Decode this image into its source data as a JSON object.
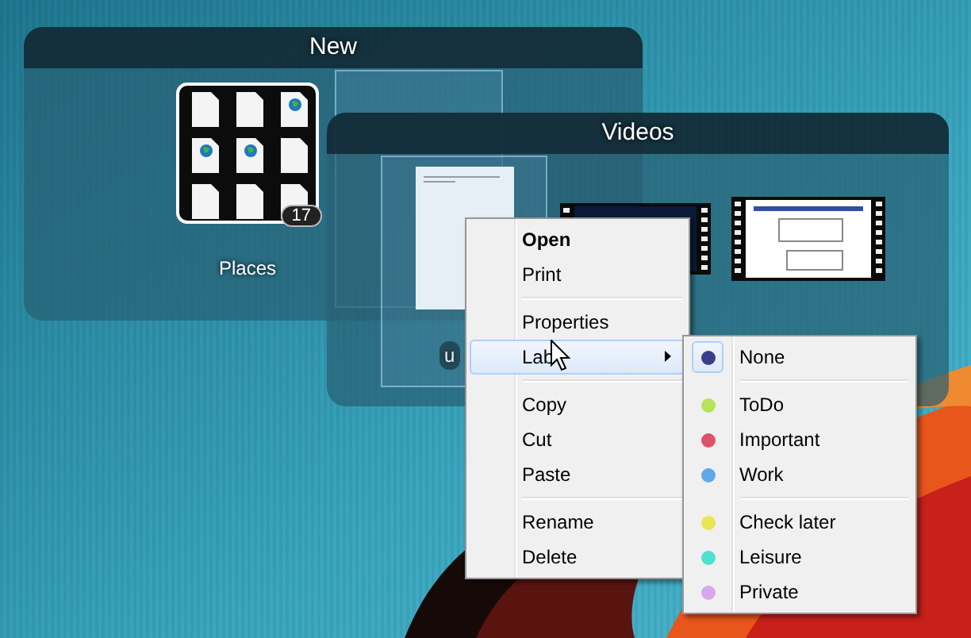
{
  "groups": [
    {
      "title": "New",
      "items": [
        {
          "kind": "stack",
          "label": "Places",
          "count": "17"
        },
        {
          "kind": "blank",
          "selected": true
        }
      ]
    },
    {
      "title": "Videos",
      "items": [
        {
          "kind": "document",
          "label": "u",
          "selected": true
        },
        {
          "kind": "video"
        },
        {
          "kind": "video"
        }
      ]
    }
  ],
  "context_menu": {
    "items": [
      {
        "kind": "item",
        "label": "Open",
        "bold": true,
        "highlighted": false,
        "has_submenu": false
      },
      {
        "kind": "item",
        "label": "Print",
        "bold": false,
        "highlighted": false,
        "has_submenu": false
      },
      {
        "kind": "separator"
      },
      {
        "kind": "item",
        "label": "Properties",
        "bold": false,
        "highlighted": false,
        "has_submenu": false
      },
      {
        "kind": "item",
        "label": "Lab",
        "bold": false,
        "highlighted": true,
        "has_submenu": true
      },
      {
        "kind": "separator"
      },
      {
        "kind": "item",
        "label": "Copy",
        "bold": false,
        "highlighted": false,
        "has_submenu": false
      },
      {
        "kind": "item",
        "label": "Cut",
        "bold": false,
        "highlighted": false,
        "has_submenu": false
      },
      {
        "kind": "item",
        "label": "Paste",
        "bold": false,
        "highlighted": false,
        "has_submenu": false
      },
      {
        "kind": "separator"
      },
      {
        "kind": "item",
        "label": "Rename",
        "bold": false,
        "highlighted": false,
        "has_submenu": false
      },
      {
        "kind": "item",
        "label": "Delete",
        "bold": false,
        "highlighted": false,
        "has_submenu": false
      }
    ]
  },
  "label_submenu": {
    "items": [
      {
        "kind": "item",
        "label": "None",
        "color": "#3a3d8c",
        "selected": true
      },
      {
        "kind": "separator"
      },
      {
        "kind": "item",
        "label": "ToDo",
        "color": "#b5e35a",
        "selected": false
      },
      {
        "kind": "item",
        "label": "Important",
        "color": "#e0506a",
        "selected": false
      },
      {
        "kind": "item",
        "label": "Work",
        "color": "#5fa8e8",
        "selected": false
      },
      {
        "kind": "separator"
      },
      {
        "kind": "item",
        "label": "Check later",
        "color": "#e8e650",
        "selected": false
      },
      {
        "kind": "item",
        "label": "Leisure",
        "color": "#50e0d0",
        "selected": false
      },
      {
        "kind": "item",
        "label": "Private",
        "color": "#d8a8ec",
        "selected": false
      }
    ]
  }
}
